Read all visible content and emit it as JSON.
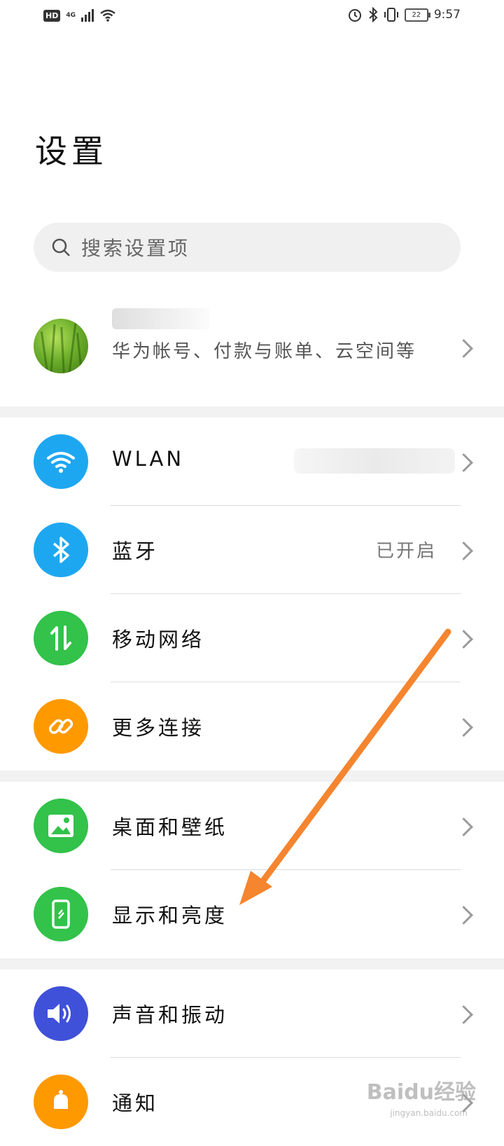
{
  "status_bar": {
    "hd": "HD",
    "network": "4G",
    "time": "9:57",
    "battery": "22"
  },
  "page_title": "设置",
  "search": {
    "placeholder": "搜索设置项"
  },
  "account": {
    "subtitle": "华为帐号、付款与账单、云空间等"
  },
  "groups": [
    {
      "items": [
        {
          "label": "WLAN",
          "icon": "wifi-icon",
          "color": "#1ea7f1",
          "value": ""
        },
        {
          "label": "蓝牙",
          "icon": "bluetooth-icon",
          "color": "#1ea7f1",
          "value": "已开启"
        },
        {
          "label": "移动网络",
          "icon": "mobile-data-icon",
          "color": "#33c24a",
          "value": ""
        },
        {
          "label": "更多连接",
          "icon": "link-icon",
          "color": "#ff9900",
          "value": ""
        }
      ]
    },
    {
      "items": [
        {
          "label": "桌面和壁纸",
          "icon": "wallpaper-icon",
          "color": "#33c24a",
          "value": ""
        },
        {
          "label": "显示和亮度",
          "icon": "display-icon",
          "color": "#33c24a",
          "value": ""
        }
      ]
    },
    {
      "items": [
        {
          "label": "声音和振动",
          "icon": "volume-icon",
          "color": "#3f51d8",
          "value": ""
        },
        {
          "label": "通知",
          "icon": "notification-icon",
          "color": "#ff9900",
          "value": ""
        }
      ]
    }
  ],
  "watermark": {
    "text": "Baidu经验",
    "sub": "jingyan.baidu.com"
  },
  "annotation_arrow_color": "#f5852f"
}
